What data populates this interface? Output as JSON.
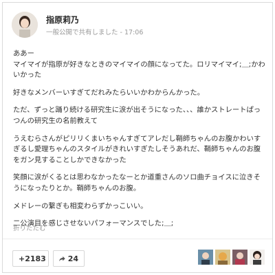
{
  "post": {
    "author": "指原莉乃",
    "visibility": "一般公開で共有しました",
    "separator": "-",
    "time": "17:06",
    "paragraphs": [
      "ああー\nマイマイが指原が好きなときのマイマイの顔になってた。ロリマイマイ;＿;かわいかった",
      "好きなメンバーいすぎてだれみたらいいかわからんかった。",
      "ただ、ずっと踊り続ける研究生に涙が出そうになった、、、誰かストレートぱっつんの研究生の名前教えて",
      "うえむらさんがピリリくまいちゃんすぎてアレだし鞘師ちゃんのお腹かわいすぎるし愛理ちゃんのスタイルがきれいすぎたしそうあれだ、鞘師ちゃんのお腹をガン見することしかできなかった",
      "笑顔に涙がくるとは思わなかったなーとか道重さんのソロ曲チョイスに泣きそうになったりとか。鞘師ちゃんのお腹。",
      "メドレーの繋ぎも相変わらずかっこいい。",
      "二公演目を感じさせないパフォーマンスでした;＿;"
    ],
    "collapse_label": "折りたたむ"
  },
  "actions": {
    "plus_count": "+2183",
    "share_count": "24"
  },
  "icons": {
    "share": "share-arrow-icon"
  }
}
